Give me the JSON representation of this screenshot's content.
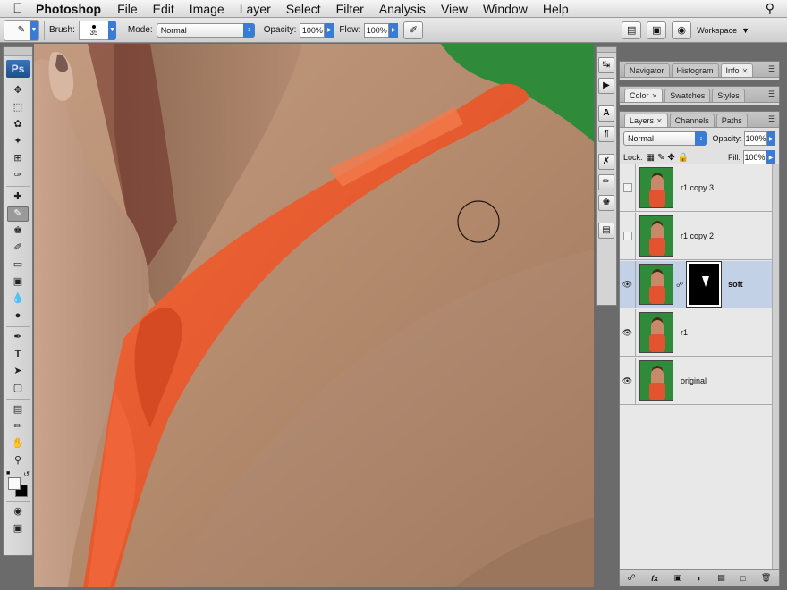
{
  "menubar": {
    "app_name": "Photoshop",
    "items": [
      "File",
      "Edit",
      "Image",
      "Layer",
      "Select",
      "Filter",
      "Analysis",
      "View",
      "Window",
      "Help"
    ]
  },
  "options_bar": {
    "brush_label": "Brush:",
    "brush_size": "35",
    "mode_label": "Mode:",
    "mode_value": "Normal",
    "opacity_label": "Opacity:",
    "opacity_value": "100%",
    "flow_label": "Flow:",
    "flow_value": "100%",
    "workspace_label": "Workspace"
  },
  "toolbox": {
    "logo": "Ps",
    "tools": [
      "move",
      "marquee",
      "lasso",
      "magic-wand",
      "crop",
      "slice",
      "healing",
      "brush",
      "clone-stamp",
      "history-brush",
      "eraser",
      "gradient",
      "blur",
      "dodge",
      "pen",
      "type",
      "path-select",
      "shape",
      "notes",
      "eyedropper",
      "hand",
      "zoom"
    ]
  },
  "panels": {
    "top_group": {
      "tabs": [
        "Navigator",
        "Histogram",
        "Info"
      ],
      "active": "Info"
    },
    "mid_group": {
      "tabs": [
        "Color",
        "Swatches",
        "Styles"
      ],
      "active": "Color"
    },
    "layers_group": {
      "tabs": [
        "Layers",
        "Channels",
        "Paths"
      ],
      "active": "Layers"
    }
  },
  "layers_panel": {
    "blend_mode": "Normal",
    "opacity_label": "Opacity:",
    "opacity_value": "100%",
    "lock_label": "Lock:",
    "fill_label": "Fill:",
    "fill_value": "100%",
    "layers": [
      {
        "name": "r1 copy 3",
        "visible": false,
        "selected": false,
        "has_mask": false
      },
      {
        "name": "r1 copy 2",
        "visible": false,
        "selected": false,
        "has_mask": false
      },
      {
        "name": "soft",
        "visible": true,
        "selected": true,
        "has_mask": true
      },
      {
        "name": "r1",
        "visible": true,
        "selected": false,
        "has_mask": false
      },
      {
        "name": "original",
        "visible": true,
        "selected": false,
        "has_mask": false
      }
    ]
  },
  "colors": {
    "skin": "#b48a6d",
    "dress": "#e9552d",
    "background_green": "#2f8a3a",
    "selection_blue": "#c2d1e6"
  }
}
